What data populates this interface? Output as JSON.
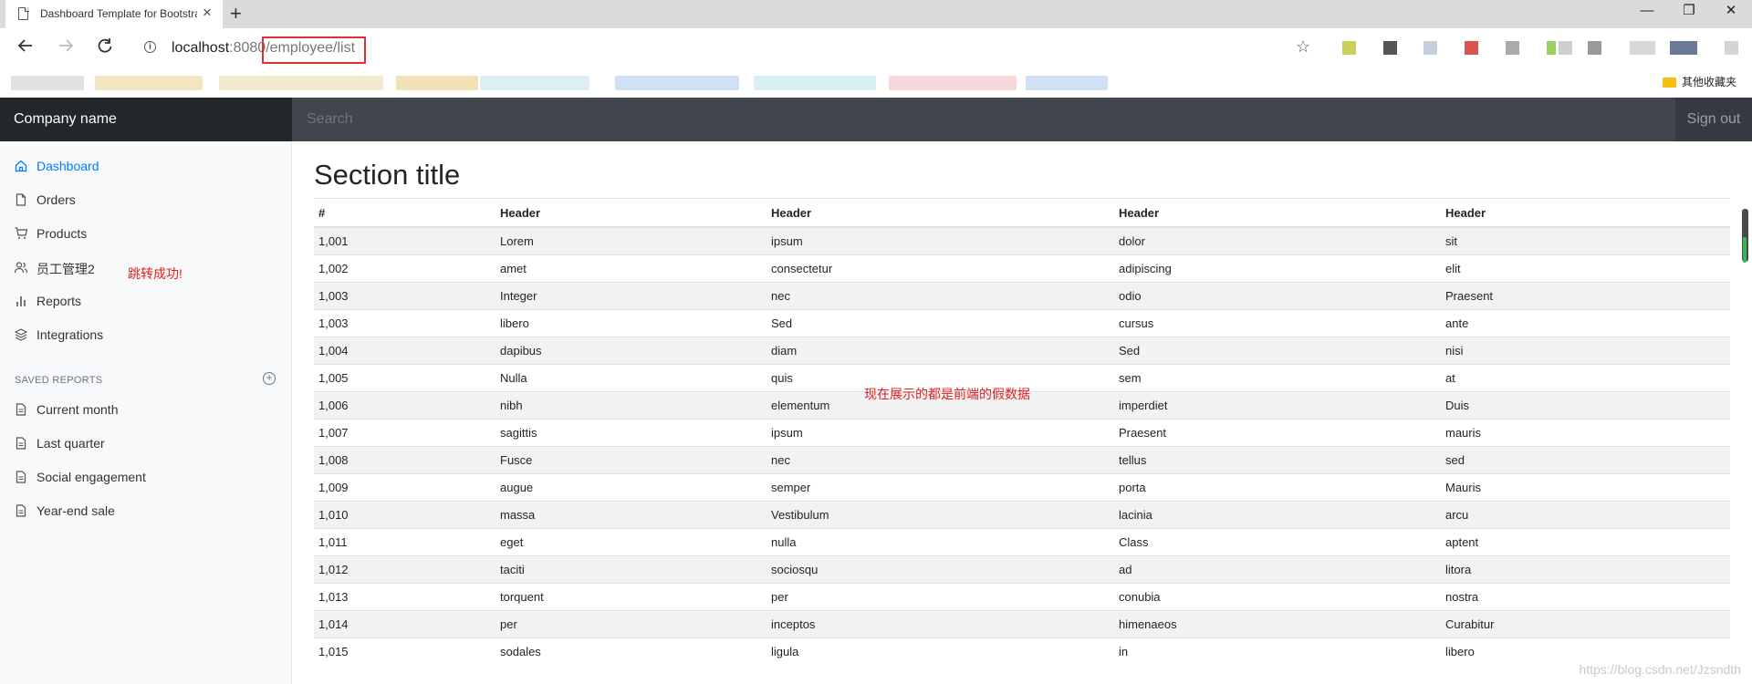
{
  "browser": {
    "tab_title": "Dashboard Template for Bootstrap",
    "tab_close": "×",
    "new_tab": "+",
    "url_host": "localhost",
    "url_port": ":8080",
    "url_path": "/employee/list",
    "bookmark_other": "其他收藏夹",
    "window_controls": [
      "—",
      "❐",
      "✕"
    ]
  },
  "topnav": {
    "brand": "Company name",
    "search_placeholder": "Search",
    "signout": "Sign out"
  },
  "sidebar": {
    "items": [
      {
        "label": "Dashboard",
        "icon": "home-icon",
        "active": true
      },
      {
        "label": "Orders",
        "icon": "file-icon"
      },
      {
        "label": "Products",
        "icon": "shopping-cart-icon"
      },
      {
        "label": "员工管理2",
        "icon": "users-icon"
      },
      {
        "label": "Reports",
        "icon": "bar-chart-icon"
      },
      {
        "label": "Integrations",
        "icon": "layers-icon"
      }
    ],
    "saved_reports_heading": "SAVED REPORTS",
    "saved_reports": [
      {
        "label": "Current month",
        "icon": "file-text-icon"
      },
      {
        "label": "Last quarter",
        "icon": "file-text-icon"
      },
      {
        "label": "Social engagement",
        "icon": "file-text-icon"
      },
      {
        "label": "Year-end sale",
        "icon": "file-text-icon"
      }
    ]
  },
  "annotations": {
    "jump_success": "跳转成功!",
    "fake_data_note": "现在展示的都是前端的假数据"
  },
  "main": {
    "section_title": "Section title",
    "table": {
      "headers": [
        "#",
        "Header",
        "Header",
        "Header",
        "Header"
      ],
      "rows": [
        [
          "1,001",
          "Lorem",
          "ipsum",
          "dolor",
          "sit"
        ],
        [
          "1,002",
          "amet",
          "consectetur",
          "adipiscing",
          "elit"
        ],
        [
          "1,003",
          "Integer",
          "nec",
          "odio",
          "Praesent"
        ],
        [
          "1,003",
          "libero",
          "Sed",
          "cursus",
          "ante"
        ],
        [
          "1,004",
          "dapibus",
          "diam",
          "Sed",
          "nisi"
        ],
        [
          "1,005",
          "Nulla",
          "quis",
          "sem",
          "at"
        ],
        [
          "1,006",
          "nibh",
          "elementum",
          "imperdiet",
          "Duis"
        ],
        [
          "1,007",
          "sagittis",
          "ipsum",
          "Praesent",
          "mauris"
        ],
        [
          "1,008",
          "Fusce",
          "nec",
          "tellus",
          "sed"
        ],
        [
          "1,009",
          "augue",
          "semper",
          "porta",
          "Mauris"
        ],
        [
          "1,010",
          "massa",
          "Vestibulum",
          "lacinia",
          "arcu"
        ],
        [
          "1,011",
          "eget",
          "nulla",
          "Class",
          "aptent"
        ],
        [
          "1,012",
          "taciti",
          "sociosqu",
          "ad",
          "litora"
        ],
        [
          "1,013",
          "torquent",
          "per",
          "conubia",
          "nostra"
        ],
        [
          "1,014",
          "per",
          "inceptos",
          "himenaeos",
          "Curabitur"
        ],
        [
          "1,015",
          "sodales",
          "ligula",
          "in",
          "libero"
        ]
      ]
    }
  },
  "watermark": "https://blog.csdn.net/Jzsndth",
  "colors": {
    "active_link": "#007bff",
    "navbar": "#343a40",
    "annotation_red": "#e02020"
  }
}
